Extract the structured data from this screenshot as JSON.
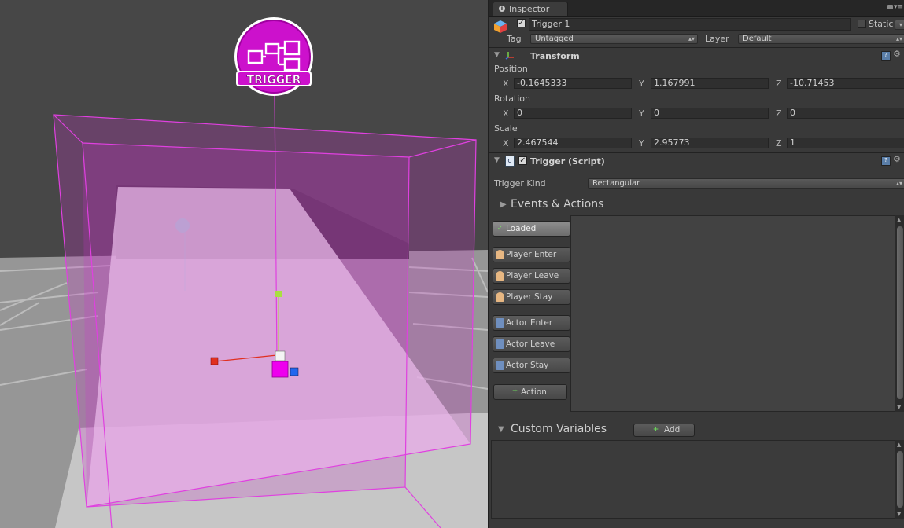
{
  "scene": {
    "gizmo_label": "TRIGGER"
  },
  "inspector": {
    "tab_label": "Inspector",
    "object": {
      "active": true,
      "name": "Trigger 1",
      "static_label": "Static",
      "static": false,
      "tag_label": "Tag",
      "tag_value": "Untagged",
      "layer_label": "Layer",
      "layer_value": "Default"
    },
    "transform": {
      "title": "Transform",
      "position_label": "Position",
      "rotation_label": "Rotation",
      "scale_label": "Scale",
      "axis_x": "X",
      "axis_y": "Y",
      "axis_z": "Z",
      "position": {
        "x": "-0.1645333",
        "y": "1.167991",
        "z": "-10.71453"
      },
      "rotation": {
        "x": "0",
        "y": "0",
        "z": "0"
      },
      "scale": {
        "x": "2.467544",
        "y": "2.95773",
        "z": "1"
      }
    },
    "trigger_script": {
      "title": "Trigger (Script)",
      "enabled": true,
      "kind_label": "Trigger Kind",
      "kind_value": "Rectangular",
      "events_title": "Events & Actions",
      "events": [
        {
          "label": "Loaded",
          "icon": "check-icon",
          "active": true
        },
        {
          "label": "Player Enter",
          "icon": "player-icon",
          "active": false
        },
        {
          "label": "Player Leave",
          "icon": "player-icon",
          "active": false
        },
        {
          "label": "Player Stay",
          "icon": "player-icon",
          "active": false
        },
        {
          "label": "Actor Enter",
          "icon": "actor-icon",
          "active": false
        },
        {
          "label": "Actor Leave",
          "icon": "actor-icon",
          "active": false
        },
        {
          "label": "Actor Stay",
          "icon": "actor-icon",
          "active": false
        }
      ],
      "add_action_label": "Action"
    },
    "custom_variables": {
      "title": "Custom Variables",
      "add_label": "Add"
    }
  },
  "colors": {
    "trigger_magenta": "#cc00cc",
    "panel_bg": "#393939",
    "scene_bg": "#474747",
    "active_check": "#7ddc68"
  }
}
